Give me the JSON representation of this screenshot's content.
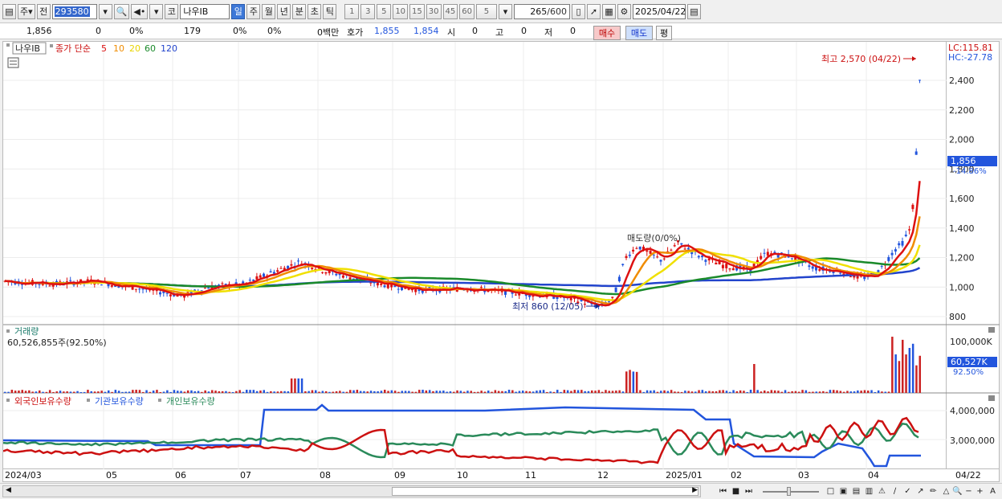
{
  "toolbar": {
    "menu_icon": "chart-menu-icon",
    "type_label": "주",
    "prev_label": "전",
    "stock_code": "293580",
    "stock_name": "나우IB",
    "code_prefix": "코",
    "periods": [
      "일",
      "주",
      "월",
      "년",
      "분",
      "초",
      "틱"
    ],
    "active_period": "일",
    "intervals": [
      "1",
      "3",
      "5",
      "10",
      "15",
      "30",
      "45",
      "60"
    ],
    "interval_value": "5",
    "count": "265",
    "count_total": "/600",
    "date": "2025/04/22"
  },
  "quote": {
    "price": "1,856",
    "change": "0",
    "change_pct": "0%",
    "volume": "179",
    "vol_pct1": "0%",
    "vol_pct2": "0%",
    "amount": "0백만",
    "hoga_label": "호가",
    "ask": "1,855",
    "bid": "1,854",
    "open_label": "시",
    "open": "0",
    "high_label": "고",
    "high": "0",
    "low_label": "저",
    "low": "0",
    "buy_label": "매수",
    "sell_label": "매도",
    "avg_label": "평"
  },
  "price_panel": {
    "stock_label": "나우IB",
    "ma_title": "종가 단순",
    "ma_periods": [
      {
        "label": "5",
        "color": "#dd1111"
      },
      {
        "label": "10",
        "color": "#f08c00"
      },
      {
        "label": "20",
        "color": "#f0e000"
      },
      {
        "label": "60",
        "color": "#1a8a2a"
      },
      {
        "label": "120",
        "color": "#2244cc"
      }
    ],
    "lc_label": "LC:115.81",
    "hc_label": "HC:-27.78",
    "high_annotation": "최고 2,570 (04/22)",
    "low_annotation": "최저 860 (12/05)",
    "overlap_text": "매도량(0/0%)",
    "current_price": "1,856",
    "current_pct": "-14.86%",
    "y_ticks": [
      "2,400",
      "2,200",
      "2,000",
      "1,800",
      "1,600",
      "1,400",
      "1,200",
      "1,000",
      "800"
    ]
  },
  "volume_panel": {
    "title": "거래량",
    "total": "60,526,855주(92.50%)",
    "y_tick": "100,000K",
    "current": "60,527K",
    "current_pct": "92.50%"
  },
  "holding_panel": {
    "series": [
      {
        "name": "외국인보유수량",
        "color": "#cc1111"
      },
      {
        "name": "기관보유수량",
        "color": "#2255dd"
      },
      {
        "name": "개인보유수량",
        "color": "#2a8a5a"
      }
    ],
    "y_ticks": [
      "4,000,000",
      "3,000,000"
    ]
  },
  "x_axis": [
    "2024/03",
    "05",
    "06",
    "07",
    "08",
    "09",
    "10",
    "11",
    "12",
    "2025/01",
    "02",
    "03",
    "04",
    "04/22"
  ],
  "colors": {
    "up": "#dd1111",
    "down": "#2255dd",
    "accent": "#3d78d8"
  }
}
